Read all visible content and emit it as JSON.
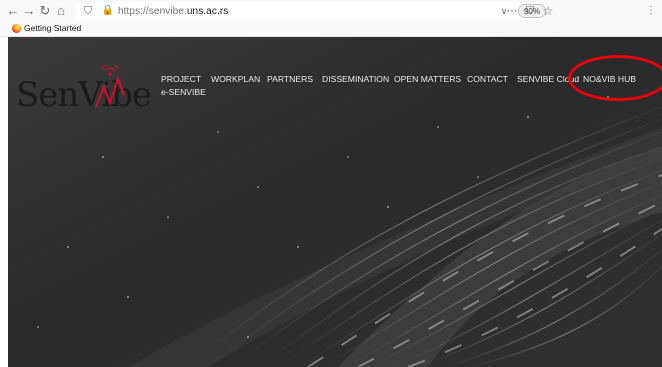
{
  "browser": {
    "url_prefix": "https://senvibe.",
    "url_domain": "uns.ac.rs",
    "zoom": "90%",
    "bookmark": "Getting Started"
  },
  "site": {
    "logo_text": "SenVibe",
    "brand_color": "#c8102e",
    "nav": {
      "project": "PROJECT",
      "workplan": "WORKPLAN",
      "partners": "PARTNERS",
      "dissemination": "DISSEMINATION",
      "open_matters": "OPEN MATTERS",
      "contact": "CONTACT",
      "senvibe_cloud": "SENVIBE Cloud",
      "novib_hub": "NO&VIB HUB",
      "e_senvibe": "e-SENVIBE"
    }
  },
  "annotation": {
    "color": "#e8000b",
    "shape": "circle highlight around NO&VIB HUB"
  }
}
